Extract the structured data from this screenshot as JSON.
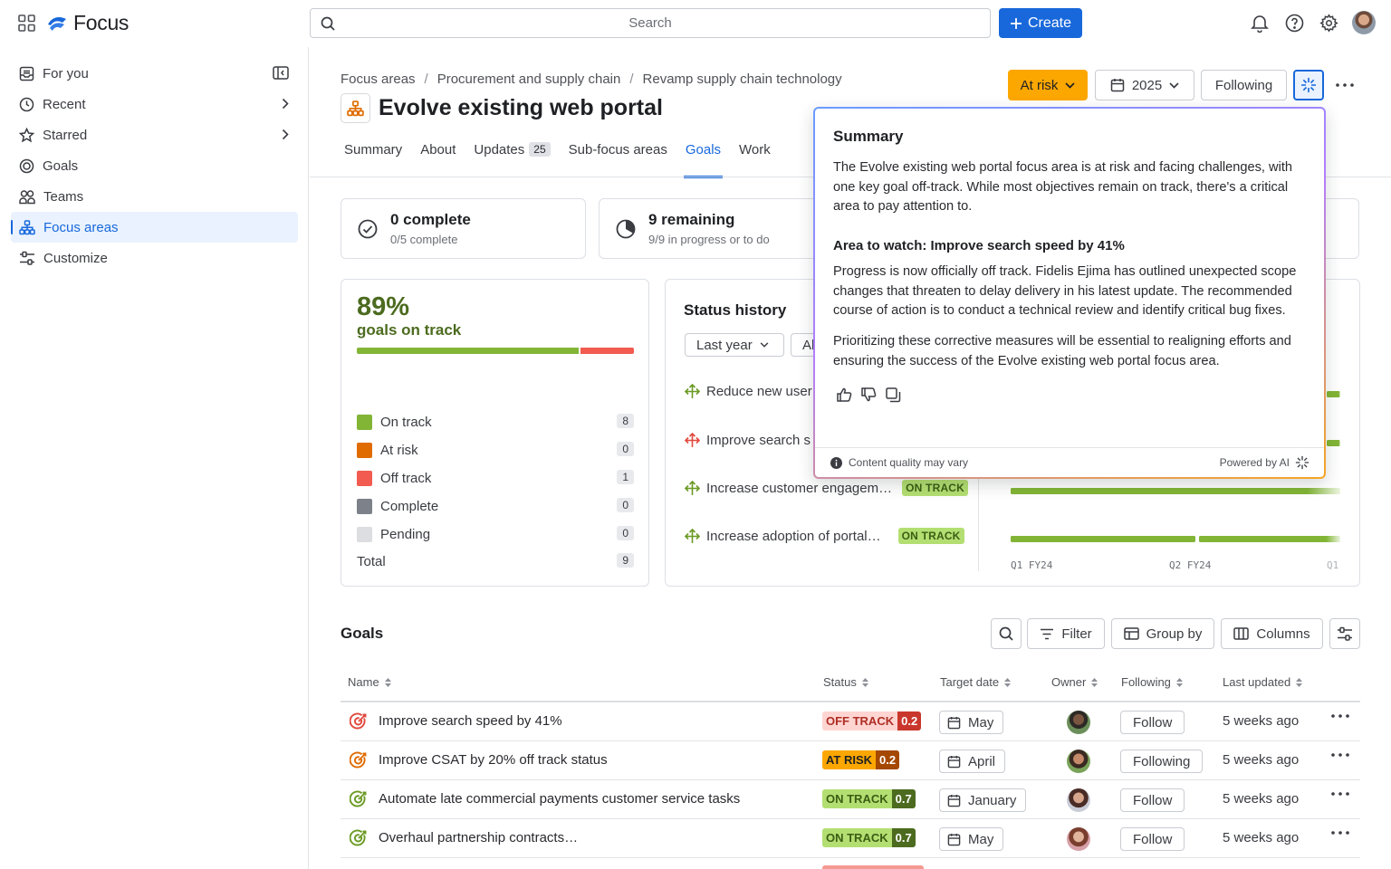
{
  "app": {
    "name": "Focus"
  },
  "search": {
    "placeholder": "Search"
  },
  "header": {
    "create_label": "Create"
  },
  "sidebar": {
    "items": [
      {
        "label": "For you"
      },
      {
        "label": "Recent"
      },
      {
        "label": "Starred"
      },
      {
        "label": "Goals"
      },
      {
        "label": "Teams"
      },
      {
        "label": "Focus areas"
      },
      {
        "label": "Customize"
      }
    ]
  },
  "breadcrumbs": [
    "Focus areas",
    "Procurement and supply chain",
    "Revamp supply chain technology"
  ],
  "page": {
    "title": "Evolve existing web portal",
    "status_label": "At risk",
    "year_label": "2025",
    "following_label": "Following"
  },
  "tabs": [
    {
      "label": "Summary"
    },
    {
      "label": "About"
    },
    {
      "label": "Updates",
      "badge": "25"
    },
    {
      "label": "Sub-focus areas"
    },
    {
      "label": "Goals"
    },
    {
      "label": "Work"
    }
  ],
  "stats": [
    {
      "title": "0 complete",
      "sub": "0/5 complete"
    },
    {
      "title": "9 remaining",
      "sub": "9/9 in progress or to do"
    }
  ],
  "on_track": {
    "percent": "89%",
    "label": "goals on track",
    "bar_fraction": 0.8,
    "legend": [
      {
        "label": "On track",
        "count": "8",
        "color": "#82b536"
      },
      {
        "label": "At risk",
        "count": "0",
        "color": "#e06c00"
      },
      {
        "label": "Off track",
        "count": "1",
        "color": "#f15b50"
      },
      {
        "label": "Complete",
        "count": "0",
        "color": "#7d818a"
      },
      {
        "label": "Pending",
        "count": "0",
        "color": "#dddee1"
      },
      {
        "label": "Total",
        "count": "9",
        "color": ""
      }
    ]
  },
  "status_history": {
    "title": "Status history",
    "filter_label": "Last year",
    "filter2_label": "Al",
    "goals": [
      {
        "label": "Reduce new user",
        "lozenge": "",
        "color": "#6a9a23"
      },
      {
        "label": "Improve search s",
        "lozenge": "",
        "color": "#e2483d"
      },
      {
        "label": "Increase customer engagem…",
        "lozenge": "ON TRACK",
        "color": "#6a9a23"
      },
      {
        "label": "Increase adoption of portal…",
        "lozenge": "ON TRACK",
        "color": "#6a9a23"
      }
    ],
    "x_ticks": [
      "Q1  FY24",
      "Q2  FY24",
      "Q1"
    ]
  },
  "goals_table": {
    "title": "Goals",
    "filter_label": "Filter",
    "group_label": "Group by",
    "columns_label": "Columns",
    "headers": [
      "Name",
      "Status",
      "Target date",
      "Owner",
      "Following",
      "Last updated"
    ],
    "rows": [
      {
        "name": "Improve search speed by 41%",
        "status": "OFF TRACK",
        "score": "0.2",
        "date": "May",
        "follow": "Follow",
        "updated": "5 weeks ago",
        "status_bg": "#ffd5d2",
        "status_fg": "#ae2e24",
        "score_bg": "#c9372c",
        "icon_color": "#e2483d"
      },
      {
        "name": "Improve CSAT by 20% off track status",
        "status": "AT RISK",
        "score": "0.2",
        "date": "April",
        "follow": "Following",
        "updated": "5 weeks ago",
        "status_bg": "#fca700",
        "status_fg": "#1f2024",
        "score_bg": "#a54800",
        "icon_color": "#e06c00"
      },
      {
        "name": "Automate late commercial payments customer service tasks",
        "status": "ON TRACK",
        "score": "0.7",
        "date": "January",
        "follow": "Follow",
        "updated": "5 weeks ago",
        "status_bg": "#b3df72",
        "status_fg": "#3b5e14",
        "score_bg": "#4c6b1f",
        "icon_color": "#6a9a23"
      },
      {
        "name": "Overhaul partnership contracts…",
        "status": "ON TRACK",
        "score": "0.7",
        "date": "May",
        "follow": "Follow",
        "updated": "5 weeks ago",
        "status_bg": "#b3df72",
        "status_fg": "#3b5e14",
        "score_bg": "#4c6b1f",
        "icon_color": "#6a9a23"
      }
    ]
  },
  "summary_popover": {
    "title": "Summary",
    "p1": "The Evolve existing web portal focus area is at risk and facing challenges, with one key goal off-track. While most objectives remain on track, there's a critical area to pay attention to.",
    "subtitle": "Area to watch: Improve search speed by 41%",
    "p2": "Progress is now officially off track. Fidelis Ejima has outlined unexpected scope changes that threaten to delay delivery in his latest update. The recommended course of action is to conduct a technical review and identify critical bug fixes.",
    "p3": "Prioritizing these corrective measures will be essential to realigning efforts and ensuring the success of the Evolve existing web portal focus area.",
    "quality_note": "Content quality may vary",
    "powered_by": "Powered by AI"
  }
}
